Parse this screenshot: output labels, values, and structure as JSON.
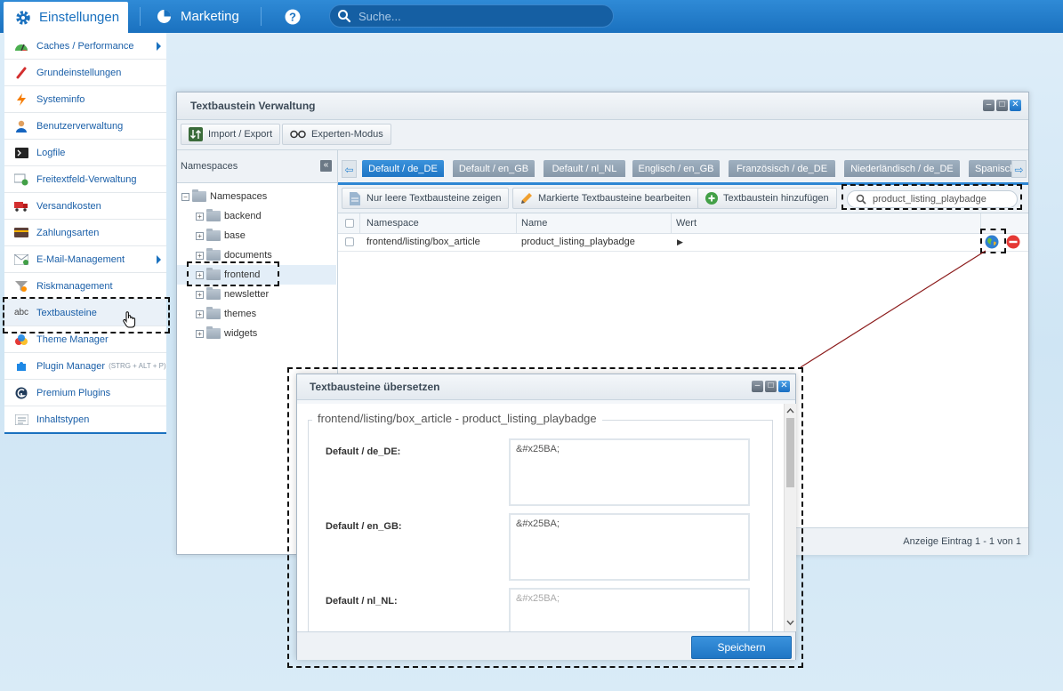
{
  "topbar": {
    "settings_label": "Einstellungen",
    "marketing_label": "Marketing",
    "search_placeholder": "Suche..."
  },
  "menu": {
    "items": [
      {
        "label": "Caches / Performance",
        "icon": "speedometer-icon"
      },
      {
        "label": "Grundeinstellungen",
        "icon": "wrench-icon"
      },
      {
        "label": "Systeminfo",
        "icon": "lightning-icon"
      },
      {
        "label": "Benutzerverwaltung",
        "icon": "user-icon"
      },
      {
        "label": "Logfile",
        "icon": "terminal-icon"
      },
      {
        "label": "Freitextfeld-Verwaltung",
        "icon": "form-add-icon"
      },
      {
        "label": "Versandkosten",
        "icon": "truck-icon"
      },
      {
        "label": "Zahlungsarten",
        "icon": "credit-card-icon"
      },
      {
        "label": "E-Mail-Management",
        "icon": "mail-icon"
      },
      {
        "label": "Riskmanagement",
        "icon": "funnel-icon"
      },
      {
        "label": "Textbausteine",
        "icon": "abc-icon",
        "icon_text": "abc"
      },
      {
        "label": "Theme Manager",
        "icon": "color-drops-icon"
      },
      {
        "label": "Plugin Manager",
        "hint": "(STRG + ALT + P)",
        "icon": "puzzle-icon"
      },
      {
        "label": "Premium Plugins",
        "icon": "premium-logo-icon"
      },
      {
        "label": "Inhaltstypen",
        "icon": "list-icon"
      }
    ]
  },
  "window": {
    "title": "Textbaustein Verwaltung",
    "import_export_label": "Import / Export",
    "expert_mode_label": "Experten-Modus"
  },
  "namespaces": {
    "header": "Namespaces",
    "root": "Namespaces",
    "children": [
      "backend",
      "base",
      "documents",
      "frontend",
      "newsletter",
      "themes",
      "widgets"
    ]
  },
  "locale_tabs": [
    "Default / de_DE",
    "Default / en_GB",
    "Default / nl_NL",
    "Englisch / en_GB",
    "Französisch / de_DE",
    "Niederländisch / de_DE",
    "Spanisch"
  ],
  "grid_toolbar": {
    "show_empty_label": "Nur leere Textbausteine zeigen",
    "edit_marked_label": "Markierte Textbausteine bearbeiten",
    "add_label": "Textbaustein hinzufügen",
    "search_value": "product_listing_playbadge"
  },
  "grid": {
    "columns": [
      "Namespace",
      "Name",
      "Wert"
    ],
    "rows": [
      {
        "namespace": "frontend/listing/box_article",
        "name": "product_listing_playbadge",
        "value": "▶"
      }
    ],
    "footer": "Anzeige Eintrag 1 - 1 von 1"
  },
  "dialog": {
    "title": "Textbausteine übersetzen",
    "legend": "frontend/listing/box_article - product_listing_playbadge",
    "fields": [
      {
        "label": "Default / de_DE:",
        "value": "&#x25BA;"
      },
      {
        "label": "Default / en_GB:",
        "value": "&#x25BA;"
      },
      {
        "label": "Default / nl_NL:",
        "value": "&#x25BA;"
      }
    ],
    "save_label": "Speichern"
  },
  "colors": {
    "topbar_blue": "#1a71bf",
    "accent_blue": "#2d86d3",
    "link_blue": "#1a5fa8",
    "connector_red": "#8b1a1a"
  }
}
